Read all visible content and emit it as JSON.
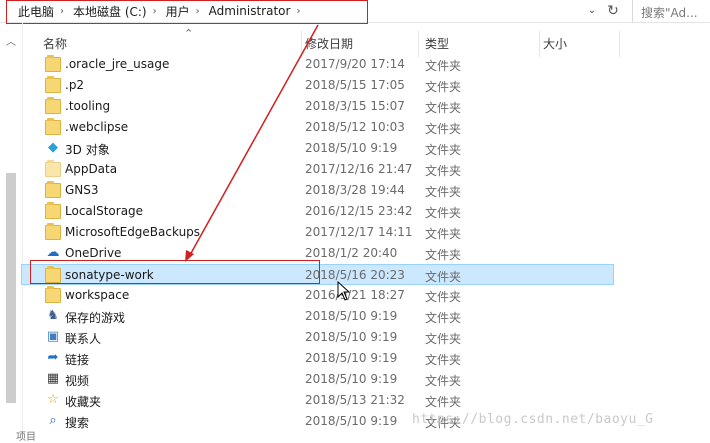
{
  "address": {
    "crumbs": [
      "此电脑",
      "本地磁盘 (C:)",
      "用户",
      "Administrator"
    ],
    "search_placeholder": "搜索\"Ad..."
  },
  "columns": {
    "name": "名称",
    "date": "修改日期",
    "type": "类型",
    "size": "大小"
  },
  "rows": [
    {
      "name": ".oracle_jre_usage",
      "date": "2017/9/20 17:14",
      "type": "文件夹",
      "icon": "folder-icon"
    },
    {
      "name": ".p2",
      "date": "2018/5/15 17:05",
      "type": "文件夹",
      "icon": "folder-icon"
    },
    {
      "name": ".tooling",
      "date": "2018/3/15 15:07",
      "type": "文件夹",
      "icon": "folder-icon"
    },
    {
      "name": ".webclipse",
      "date": "2018/5/12 10:03",
      "type": "文件夹",
      "icon": "folder-icon"
    },
    {
      "name": "3D 对象",
      "date": "2018/5/10 9:19",
      "type": "文件夹",
      "icon": "3d-objects-icon"
    },
    {
      "name": "AppData",
      "date": "2017/12/16 21:47",
      "type": "文件夹",
      "icon": "folder-icon"
    },
    {
      "name": "GNS3",
      "date": "2018/3/28 19:44",
      "type": "文件夹",
      "icon": "folder-icon"
    },
    {
      "name": "LocalStorage",
      "date": "2016/12/15 23:42",
      "type": "文件夹",
      "icon": "folder-icon"
    },
    {
      "name": "MicrosoftEdgeBackups",
      "date": "2017/12/17 14:11",
      "type": "文件夹",
      "icon": "folder-icon"
    },
    {
      "name": "OneDrive",
      "date": "2018/1/2 20:40",
      "type": "文件夹",
      "icon": "onedrive-icon"
    },
    {
      "name": "sonatype-work",
      "date": "2018/5/16 20:23",
      "type": "文件夹",
      "icon": "folder-icon",
      "selected": true
    },
    {
      "name": "workspace",
      "date": "2016/9/21 18:27",
      "type": "文件夹",
      "icon": "folder-icon"
    },
    {
      "name": "保存的游戏",
      "date": "2018/5/10 9:19",
      "type": "文件夹",
      "icon": "saved-games-icon"
    },
    {
      "name": "联系人",
      "date": "2018/5/10 9:19",
      "type": "文件夹",
      "icon": "contacts-icon"
    },
    {
      "name": "链接",
      "date": "2018/5/10 9:19",
      "type": "文件夹",
      "icon": "links-icon"
    },
    {
      "name": "视频",
      "date": "2018/5/10 9:19",
      "type": "文件夹",
      "icon": "videos-icon"
    },
    {
      "name": "收藏夹",
      "date": "2018/5/13 21:32",
      "type": "文件夹",
      "icon": "favorites-icon"
    },
    {
      "name": "搜索",
      "date": "2018/5/10 9:19",
      "type": "文件夹",
      "icon": "searches-icon"
    }
  ],
  "watermark": "https://blog.csdn.net/baoyu_G",
  "status_text": "项目"
}
